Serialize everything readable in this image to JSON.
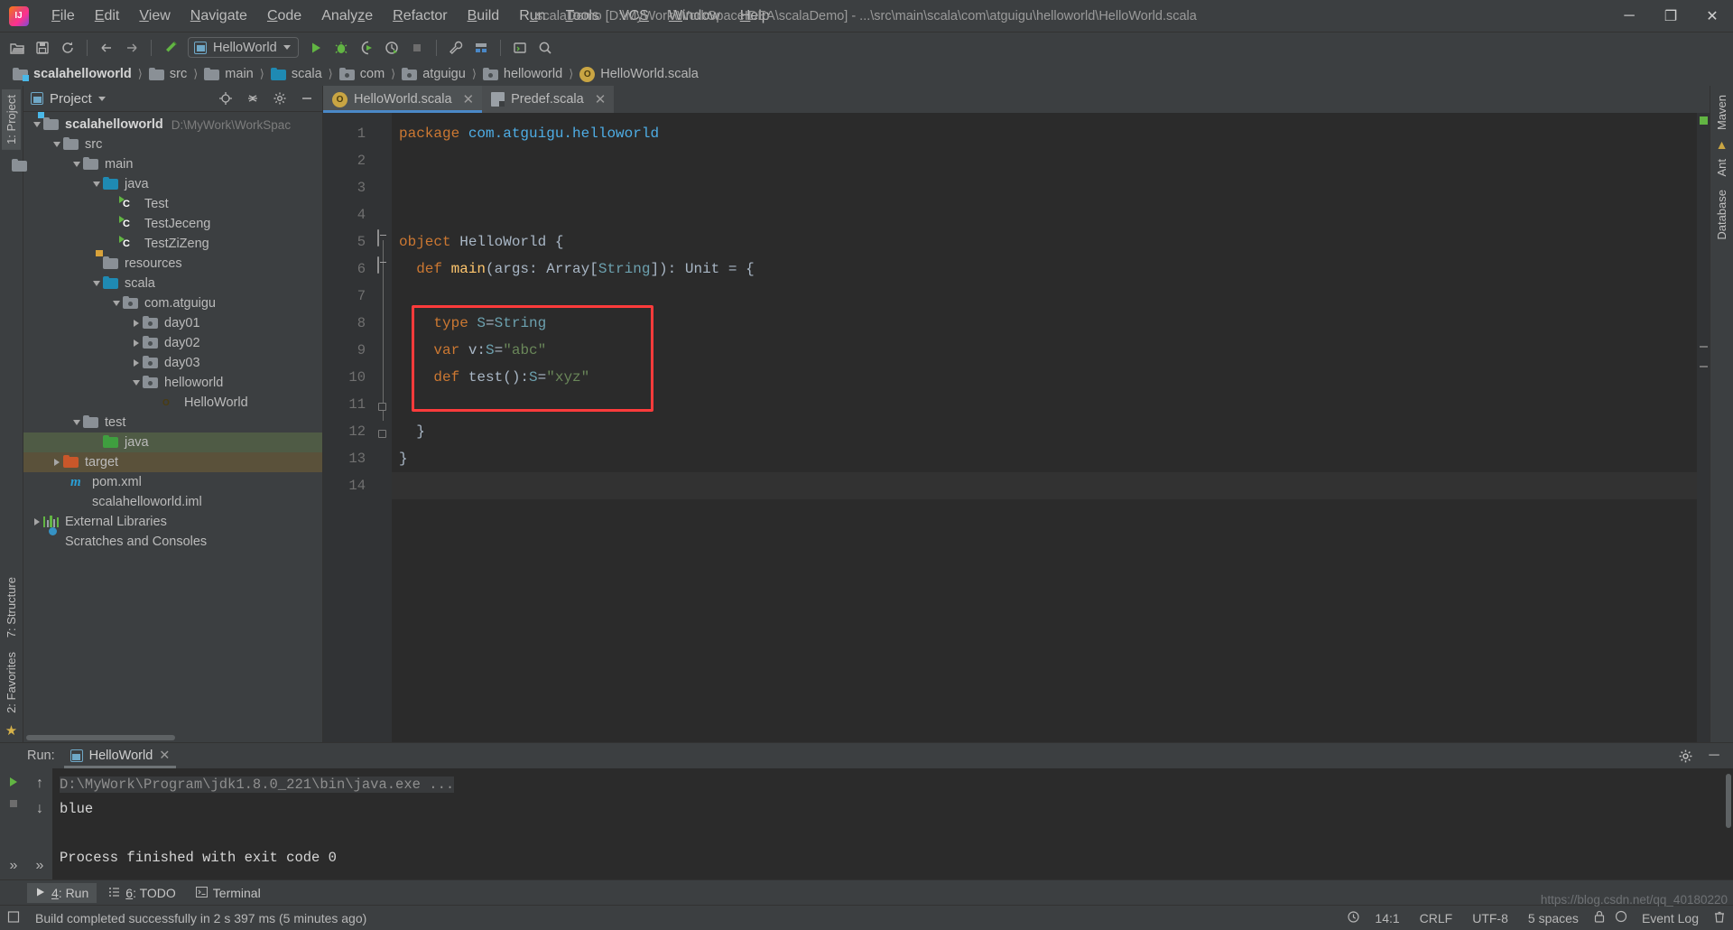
{
  "window": {
    "title": "scalaDemo [D:\\MyWork\\WorkSpaceIDEA\\scalaDemo] - ...\\src\\main\\scala\\com\\atguigu\\helloworld\\HelloWorld.scala",
    "minimize_label": "─",
    "maximize_label": "❐",
    "close_label": "✕"
  },
  "menubar": {
    "items": [
      {
        "label": "File"
      },
      {
        "label": "Edit"
      },
      {
        "label": "View"
      },
      {
        "label": "Navigate"
      },
      {
        "label": "Code"
      },
      {
        "label": "Analyze"
      },
      {
        "label": "Refactor"
      },
      {
        "label": "Build"
      },
      {
        "label": "Run"
      },
      {
        "label": "Tools"
      },
      {
        "label": "VCS"
      },
      {
        "label": "Window"
      },
      {
        "label": "Help"
      }
    ]
  },
  "toolbar": {
    "run_config": "HelloWorld",
    "buttons": [
      {
        "name": "open-icon"
      },
      {
        "name": "save-all-icon"
      },
      {
        "name": "sync-icon"
      },
      {
        "name": "back-icon"
      },
      {
        "name": "forward-icon"
      },
      {
        "name": "build-hammer-icon"
      },
      {
        "name": "run-icon"
      },
      {
        "name": "debug-icon"
      },
      {
        "name": "run-with-coverage-icon"
      },
      {
        "name": "profile-icon"
      },
      {
        "name": "stop-icon"
      },
      {
        "name": "settings-wrench-icon"
      },
      {
        "name": "project-structure-icon"
      },
      {
        "name": "terminal-icon"
      },
      {
        "name": "search-everywhere-icon"
      }
    ]
  },
  "breadcrumb": {
    "items": [
      {
        "label": "scalahelloworld",
        "icon": "module-folder-icon",
        "bold": true
      },
      {
        "label": "src",
        "icon": "folder-icon",
        "bold": false
      },
      {
        "label": "main",
        "icon": "folder-icon",
        "bold": false
      },
      {
        "label": "scala",
        "icon": "source-folder-icon",
        "bold": false
      },
      {
        "label": "com",
        "icon": "package-icon",
        "bold": false
      },
      {
        "label": "atguigu",
        "icon": "package-icon",
        "bold": false
      },
      {
        "label": "helloworld",
        "icon": "package-icon",
        "bold": false
      },
      {
        "label": "HelloWorld.scala",
        "icon": "scala-object-icon",
        "bold": false
      }
    ]
  },
  "left_strip": {
    "top_tab": "1: Project",
    "bottom_tabs": [
      "2: Favorites",
      "7: Structure"
    ]
  },
  "right_strip": {
    "tabs": [
      "Maven",
      "Ant",
      "Database"
    ]
  },
  "project_panel": {
    "title": "Project",
    "header_icons": [
      "locate-icon",
      "collapse-all-icon",
      "gear-icon",
      "hide-icon"
    ],
    "tree": [
      {
        "indent": 0,
        "twisty": "down",
        "icon": "module-folder-icon",
        "label": "scalahelloworld",
        "bold": true,
        "path": "D:\\MyWork\\WorkSpac",
        "state": "normal"
      },
      {
        "indent": 1,
        "twisty": "down",
        "icon": "folder-icon",
        "label": "src",
        "bold": false,
        "path": "",
        "state": "normal"
      },
      {
        "indent": 2,
        "twisty": "down",
        "icon": "folder-icon",
        "label": "main",
        "bold": false,
        "path": "",
        "state": "normal"
      },
      {
        "indent": 3,
        "twisty": "down",
        "icon": "source-folder-icon",
        "label": "java",
        "bold": false,
        "path": "",
        "state": "normal"
      },
      {
        "indent": 5,
        "twisty": "none",
        "icon": "java-class-icon",
        "label": "Test",
        "bold": false,
        "path": "",
        "state": "normal"
      },
      {
        "indent": 5,
        "twisty": "none",
        "icon": "java-class-icon",
        "label": "TestJeceng",
        "bold": false,
        "path": "",
        "state": "normal"
      },
      {
        "indent": 5,
        "twisty": "none",
        "icon": "java-class-icon",
        "label": "TestZiZeng",
        "bold": false,
        "path": "",
        "state": "normal"
      },
      {
        "indent": 4,
        "twisty": "none",
        "icon": "resources-folder-icon",
        "label": "resources",
        "bold": false,
        "path": "",
        "state": "normal"
      },
      {
        "indent": 3,
        "twisty": "down",
        "icon": "source-folder-icon",
        "label": "scala",
        "bold": false,
        "path": "",
        "state": "normal"
      },
      {
        "indent": 4,
        "twisty": "down",
        "icon": "package-icon",
        "label": "com.atguigu",
        "bold": false,
        "path": "",
        "state": "normal"
      },
      {
        "indent": 5,
        "twisty": "right",
        "icon": "package-icon",
        "label": "day01",
        "bold": false,
        "path": "",
        "state": "normal"
      },
      {
        "indent": 5,
        "twisty": "right",
        "icon": "package-icon",
        "label": "day02",
        "bold": false,
        "path": "",
        "state": "normal"
      },
      {
        "indent": 5,
        "twisty": "right",
        "icon": "package-icon",
        "label": "day03",
        "bold": false,
        "path": "",
        "state": "normal"
      },
      {
        "indent": 5,
        "twisty": "down",
        "icon": "package-icon",
        "label": "helloworld",
        "bold": false,
        "path": "",
        "state": "normal"
      },
      {
        "indent": 7,
        "twisty": "none",
        "icon": "scala-object-icon",
        "label": "HelloWorld",
        "bold": false,
        "path": "",
        "state": "normal"
      },
      {
        "indent": 2,
        "twisty": "down",
        "icon": "folder-icon",
        "label": "test",
        "bold": false,
        "path": "",
        "state": "normal"
      },
      {
        "indent": 4,
        "twisty": "none",
        "icon": "test-source-folder-icon",
        "label": "java",
        "bold": false,
        "path": "",
        "state": "selected-green"
      },
      {
        "indent": 1,
        "twisty": "right",
        "icon": "excluded-folder-icon",
        "label": "target",
        "bold": false,
        "path": "",
        "state": "selected-brown"
      },
      {
        "indent": 2,
        "twisty": "none",
        "icon": "maven-icon",
        "label": "pom.xml",
        "bold": false,
        "path": "",
        "state": "normal"
      },
      {
        "indent": 2,
        "twisty": "none",
        "icon": "iml-file-icon",
        "label": "scalahelloworld.iml",
        "bold": false,
        "path": "",
        "state": "normal"
      },
      {
        "indent": 0,
        "twisty": "right",
        "icon": "libraries-icon",
        "label": "External Libraries",
        "bold": false,
        "path": "",
        "state": "normal"
      },
      {
        "indent": 0,
        "twisty": "none",
        "icon": "scratches-icon",
        "label": "Scratches and Consoles",
        "bold": false,
        "path": "",
        "state": "normal"
      }
    ]
  },
  "editor": {
    "tabs": [
      {
        "label": "HelloWorld.scala",
        "icon": "scala-object-icon",
        "active": true,
        "close": "✕"
      },
      {
        "label": "Predef.scala",
        "icon": "scala-readonly-icon",
        "active": false,
        "close": "✕"
      }
    ],
    "line_numbers": [
      "1",
      "2",
      "3",
      "4",
      "5",
      "6",
      "7",
      "8",
      "9",
      "10",
      "11",
      "12",
      "13",
      "14"
    ],
    "lines": [
      {
        "n": 1,
        "tokens": [
          {
            "t": "package ",
            "c": "kw"
          },
          {
            "t": "com.atguigu.helloworld",
            "c": "typ"
          }
        ]
      },
      {
        "n": 2,
        "tokens": []
      },
      {
        "n": 3,
        "tokens": []
      },
      {
        "n": 4,
        "tokens": []
      },
      {
        "n": 5,
        "tokens": [
          {
            "t": "object ",
            "c": "kw"
          },
          {
            "t": "HelloWorld",
            "c": "pln"
          },
          {
            "t": " {",
            "c": "pln"
          }
        ]
      },
      {
        "n": 6,
        "tokens": [
          {
            "t": "  def ",
            "c": "kw"
          },
          {
            "t": "main",
            "c": "fn"
          },
          {
            "t": "(args: ",
            "c": "pln"
          },
          {
            "t": "Array",
            "c": "pln"
          },
          {
            "t": "[",
            "c": "pln"
          },
          {
            "t": "String",
            "c": "typg"
          },
          {
            "t": "]): ",
            "c": "pln"
          },
          {
            "t": "Unit",
            "c": "pln"
          },
          {
            "t": " = {",
            "c": "pln"
          }
        ]
      },
      {
        "n": 7,
        "tokens": []
      },
      {
        "n": 8,
        "tokens": [
          {
            "t": "    type ",
            "c": "kw"
          },
          {
            "t": "S",
            "c": "typg"
          },
          {
            "t": "=",
            "c": "pln"
          },
          {
            "t": "String",
            "c": "typg"
          }
        ]
      },
      {
        "n": 9,
        "tokens": [
          {
            "t": "    var ",
            "c": "kw"
          },
          {
            "t": "v",
            "c": "pln"
          },
          {
            "t": ":",
            "c": "pln"
          },
          {
            "t": "S",
            "c": "typg"
          },
          {
            "t": "=",
            "c": "pln"
          },
          {
            "t": "\"abc\"",
            "c": "str"
          }
        ]
      },
      {
        "n": 10,
        "tokens": [
          {
            "t": "    def ",
            "c": "kw"
          },
          {
            "t": "test",
            "c": "pln"
          },
          {
            "t": "():",
            "c": "pln"
          },
          {
            "t": "S",
            "c": "typg"
          },
          {
            "t": "=",
            "c": "pln"
          },
          {
            "t": "\"xyz\"",
            "c": "str"
          }
        ]
      },
      {
        "n": 11,
        "tokens": []
      },
      {
        "n": 12,
        "tokens": [
          {
            "t": "  }",
            "c": "pln"
          }
        ]
      },
      {
        "n": 13,
        "tokens": [
          {
            "t": "}",
            "c": "pln"
          }
        ]
      },
      {
        "n": 14,
        "tokens": []
      }
    ],
    "annotation": {
      "color": "#ff3b3b",
      "covers_lines": "8-10"
    }
  },
  "run_panel": {
    "label": "Run:",
    "tab": "HelloWorld",
    "tab_close": "✕",
    "gear_icon": "⚙",
    "minimize_icon": "─",
    "console": [
      {
        "text": "D:\\MyWork\\Program\\jdk1.8.0_221\\bin\\java.exe ...",
        "style": "cmd"
      },
      {
        "text": "blue",
        "style": "out"
      },
      {
        "text": "",
        "style": "out"
      },
      {
        "text": "Process finished with exit code 0",
        "style": "out"
      }
    ],
    "side_buttons": [
      "rerun-icon",
      "stop-icon",
      "expand-icon",
      "up-icon",
      "down-icon",
      "expand2-icon"
    ]
  },
  "tool_window_bar": {
    "items": [
      {
        "label": "4: Run",
        "icon": "run-icon",
        "active": true
      },
      {
        "label": "6: TODO",
        "icon": "todo-icon",
        "active": false
      },
      {
        "label": "Terminal",
        "icon": "terminal-icon",
        "active": false
      }
    ]
  },
  "status_bar": {
    "message": "Build completed successfully in 2 s 397 ms (5 minutes ago)",
    "caret": "14:1",
    "line_sep": "CRLF",
    "encoding": "UTF-8",
    "indent": "5 spaces",
    "event_log": "Event Log",
    "watermark": "https://blog.csdn.net/qq_40180220"
  },
  "colors": {
    "accent": "#4a88c7",
    "run_green": "#62b543",
    "annotation_red": "#ff3b3b",
    "panel_bg": "#3c3f41",
    "editor_bg": "#2b2b2b",
    "gutter_bg": "#313335"
  }
}
